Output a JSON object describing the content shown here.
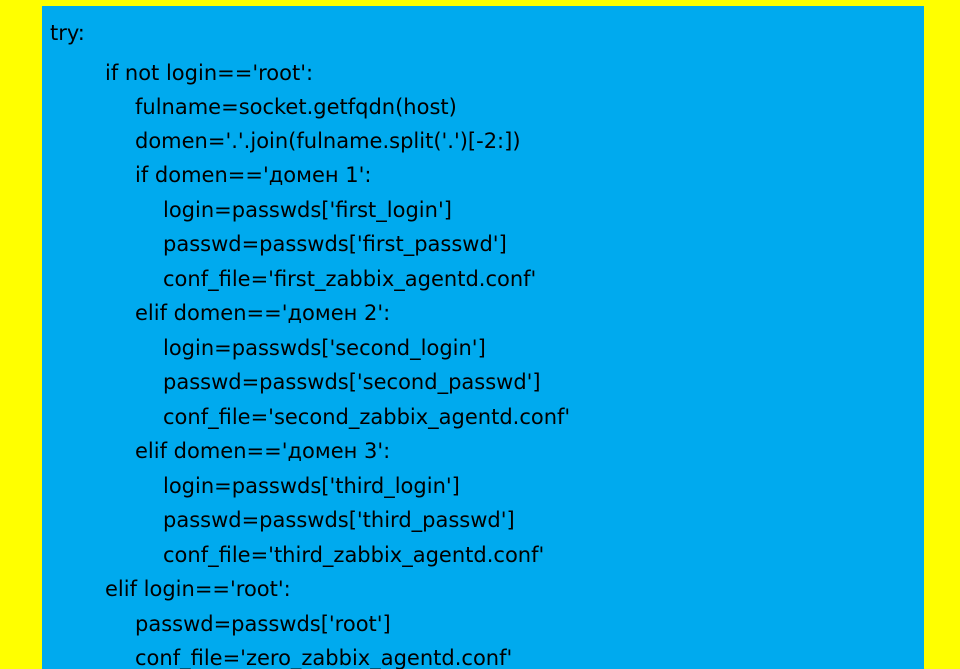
{
  "code": {
    "lines": [
      "try:",
      "if not login=='root':",
      "fulname=socket.getfqdn(host)",
      "domen='.'.join(fulname.split('.')[-2:])",
      "if domen=='домен 1':",
      "login=passwds['first_login']",
      "passwd=passwds['first_passwd']",
      "conf_file='first_zabbix_agentd.conf'",
      "elif domen=='домен 2':",
      "login=passwds['second_login']",
      "passwd=passwds['second_passwd']",
      "conf_file='second_zabbix_agentd.conf'",
      "elif domen=='домен 3':",
      "login=passwds['third_login']",
      "passwd=passwds['third_passwd']",
      "conf_file='third_zabbix_agentd.conf'",
      "elif login=='root':",
      "passwd=passwds['root']",
      "conf_file='zero_zabbix_agentd.conf'"
    ]
  }
}
